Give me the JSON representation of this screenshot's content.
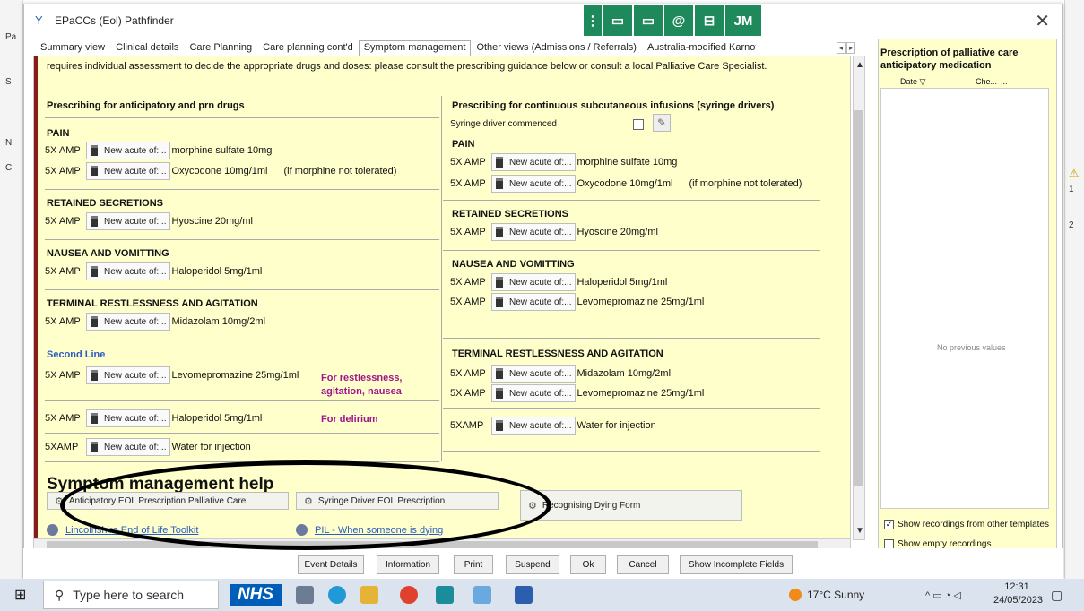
{
  "background": {
    "left_labels": [
      "Pa",
      "S",
      "N",
      "C"
    ],
    "right_labels": [
      "1",
      "2"
    ]
  },
  "window": {
    "title": "EPaCCs (Eol) Pathfinder",
    "close": "✕"
  },
  "teams_bar": {
    "initials": "JM"
  },
  "tabs": [
    {
      "label": "Summary view"
    },
    {
      "label": "Clinical details"
    },
    {
      "label": "Care Planning"
    },
    {
      "label": "Care planning cont'd"
    },
    {
      "label": "Symptom management"
    },
    {
      "label": "Other views (Admissions / Referrals)"
    },
    {
      "label": "Australia-modified Karnofsky"
    }
  ],
  "content": {
    "intro": "requires individual assessment to decide the appropriate drugs and doses: please consult the prescribing guidance below or consult a local Palliative Care Specialist.",
    "left_heading": "Prescribing for anticipatory and prn drugs",
    "right_heading": "Prescribing for continuous subcutaneous infusions (syringe drivers)",
    "syringe_commenced": "Syringe driver commenced",
    "new_acute": "New acute of:...",
    "left": {
      "pain": "PAIN",
      "pain_rows": [
        {
          "qty": "5X AMP",
          "drug": "morphine sulfate 10mg",
          "note": ""
        },
        {
          "qty": "5X AMP",
          "drug": "Oxycodone 10mg/1ml",
          "note": "(if morphine not tolerated)"
        }
      ],
      "secretions": "RETAINED SECRETIONS",
      "secretions_rows": [
        {
          "qty": "5X AMP",
          "drug": "Hyoscine 20mg/ml"
        }
      ],
      "nausea": "NAUSEA AND VOMITTING",
      "nausea_rows": [
        {
          "qty": "5X AMP",
          "drug": "Haloperidol 5mg/1ml"
        }
      ],
      "restless": "TERMINAL RESTLESSNESS AND AGITATION",
      "restless_rows": [
        {
          "qty": "5X AMP",
          "drug": "Midazolam 10mg/2ml"
        }
      ],
      "second_line": "Second Line",
      "second_rows": [
        {
          "qty": "5X AMP",
          "drug": "Levomepromazine 25mg/1ml"
        },
        {
          "qty": "5X AMP",
          "drug": "Haloperidol 5mg/1ml"
        },
        {
          "qty": "5XAMP",
          "drug": "Water for injection"
        }
      ],
      "note_restless_1": "For restlessness,",
      "note_restless_2": "agitation, nausea",
      "note_delirium": "For delirium"
    },
    "right": {
      "pain": "PAIN",
      "pain_rows": [
        {
          "qty": "5X AMP",
          "drug": "morphine sulfate 10mg",
          "note": ""
        },
        {
          "qty": "5X AMP",
          "drug": "Oxycodone 10mg/1ml",
          "note": "(if morphine not tolerated)"
        }
      ],
      "secretions": "RETAINED SECRETIONS",
      "secretions_rows": [
        {
          "qty": "5X AMP",
          "drug": "Hyoscine 20mg/ml"
        }
      ],
      "nausea": "NAUSEA AND VOMITTING",
      "nausea_rows": [
        {
          "qty": "5X AMP",
          "drug": "Haloperidol 5mg/1ml"
        },
        {
          "qty": "5X AMP",
          "drug": "Levomepromazine 25mg/1ml"
        }
      ],
      "restless": "TERMINAL RESTLESSNESS AND AGITATION",
      "restless_rows": [
        {
          "qty": "5X AMP",
          "drug": "Midazolam 10mg/2ml"
        },
        {
          "qty": "5X AMP",
          "drug": "Levomepromazine 25mg/1ml"
        }
      ],
      "water_row": {
        "qty": "5XAMP",
        "drug": "Water for injection"
      }
    },
    "help": {
      "title": "Symptom management help",
      "btn_anticipatory": "Anticipatory EOL Prescription Palliative Care",
      "btn_syringe": "Syringe Driver EOL Prescription",
      "btn_dying": "Recognising Dying Form",
      "link_toolkit": "Lincolnshire End of Life Toolkit",
      "link_pil": "PIL - When someone is dying"
    }
  },
  "right_panel": {
    "title": "Prescription of palliative care anticipatory medication",
    "col_date": "Date",
    "col_che": "Che...",
    "col_more": "...",
    "empty": "No previous values",
    "show_other": "Show recordings from other templates",
    "show_empty": "Show empty recordings"
  },
  "bottom_buttons": {
    "event_details": "Event Details",
    "information": "Information",
    "print": "Print",
    "suspend": "Suspend",
    "ok": "Ok",
    "cancel": "Cancel",
    "incomplete": "Show Incomplete Fields"
  },
  "taskbar": {
    "search_placeholder": "Type here to search",
    "nhs": "NHS",
    "weather": "17°C  Sunny",
    "time": "12:31",
    "date": "24/05/2023"
  }
}
